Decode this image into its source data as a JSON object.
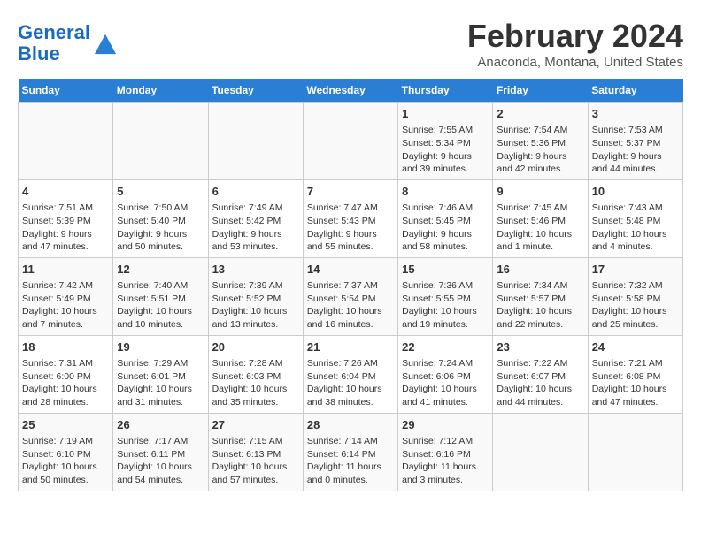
{
  "header": {
    "logo_line1": "General",
    "logo_line2": "Blue",
    "title": "February 2024",
    "subtitle": "Anaconda, Montana, United States"
  },
  "days_of_week": [
    "Sunday",
    "Monday",
    "Tuesday",
    "Wednesday",
    "Thursday",
    "Friday",
    "Saturday"
  ],
  "weeks": [
    [
      {
        "day": "",
        "info": ""
      },
      {
        "day": "",
        "info": ""
      },
      {
        "day": "",
        "info": ""
      },
      {
        "day": "",
        "info": ""
      },
      {
        "day": "1",
        "info": "Sunrise: 7:55 AM\nSunset: 5:34 PM\nDaylight: 9 hours\nand 39 minutes."
      },
      {
        "day": "2",
        "info": "Sunrise: 7:54 AM\nSunset: 5:36 PM\nDaylight: 9 hours\nand 42 minutes."
      },
      {
        "day": "3",
        "info": "Sunrise: 7:53 AM\nSunset: 5:37 PM\nDaylight: 9 hours\nand 44 minutes."
      }
    ],
    [
      {
        "day": "4",
        "info": "Sunrise: 7:51 AM\nSunset: 5:39 PM\nDaylight: 9 hours\nand 47 minutes."
      },
      {
        "day": "5",
        "info": "Sunrise: 7:50 AM\nSunset: 5:40 PM\nDaylight: 9 hours\nand 50 minutes."
      },
      {
        "day": "6",
        "info": "Sunrise: 7:49 AM\nSunset: 5:42 PM\nDaylight: 9 hours\nand 53 minutes."
      },
      {
        "day": "7",
        "info": "Sunrise: 7:47 AM\nSunset: 5:43 PM\nDaylight: 9 hours\nand 55 minutes."
      },
      {
        "day": "8",
        "info": "Sunrise: 7:46 AM\nSunset: 5:45 PM\nDaylight: 9 hours\nand 58 minutes."
      },
      {
        "day": "9",
        "info": "Sunrise: 7:45 AM\nSunset: 5:46 PM\nDaylight: 10 hours\nand 1 minute."
      },
      {
        "day": "10",
        "info": "Sunrise: 7:43 AM\nSunset: 5:48 PM\nDaylight: 10 hours\nand 4 minutes."
      }
    ],
    [
      {
        "day": "11",
        "info": "Sunrise: 7:42 AM\nSunset: 5:49 PM\nDaylight: 10 hours\nand 7 minutes."
      },
      {
        "day": "12",
        "info": "Sunrise: 7:40 AM\nSunset: 5:51 PM\nDaylight: 10 hours\nand 10 minutes."
      },
      {
        "day": "13",
        "info": "Sunrise: 7:39 AM\nSunset: 5:52 PM\nDaylight: 10 hours\nand 13 minutes."
      },
      {
        "day": "14",
        "info": "Sunrise: 7:37 AM\nSunset: 5:54 PM\nDaylight: 10 hours\nand 16 minutes."
      },
      {
        "day": "15",
        "info": "Sunrise: 7:36 AM\nSunset: 5:55 PM\nDaylight: 10 hours\nand 19 minutes."
      },
      {
        "day": "16",
        "info": "Sunrise: 7:34 AM\nSunset: 5:57 PM\nDaylight: 10 hours\nand 22 minutes."
      },
      {
        "day": "17",
        "info": "Sunrise: 7:32 AM\nSunset: 5:58 PM\nDaylight: 10 hours\nand 25 minutes."
      }
    ],
    [
      {
        "day": "18",
        "info": "Sunrise: 7:31 AM\nSunset: 6:00 PM\nDaylight: 10 hours\nand 28 minutes."
      },
      {
        "day": "19",
        "info": "Sunrise: 7:29 AM\nSunset: 6:01 PM\nDaylight: 10 hours\nand 31 minutes."
      },
      {
        "day": "20",
        "info": "Sunrise: 7:28 AM\nSunset: 6:03 PM\nDaylight: 10 hours\nand 35 minutes."
      },
      {
        "day": "21",
        "info": "Sunrise: 7:26 AM\nSunset: 6:04 PM\nDaylight: 10 hours\nand 38 minutes."
      },
      {
        "day": "22",
        "info": "Sunrise: 7:24 AM\nSunset: 6:06 PM\nDaylight: 10 hours\nand 41 minutes."
      },
      {
        "day": "23",
        "info": "Sunrise: 7:22 AM\nSunset: 6:07 PM\nDaylight: 10 hours\nand 44 minutes."
      },
      {
        "day": "24",
        "info": "Sunrise: 7:21 AM\nSunset: 6:08 PM\nDaylight: 10 hours\nand 47 minutes."
      }
    ],
    [
      {
        "day": "25",
        "info": "Sunrise: 7:19 AM\nSunset: 6:10 PM\nDaylight: 10 hours\nand 50 minutes."
      },
      {
        "day": "26",
        "info": "Sunrise: 7:17 AM\nSunset: 6:11 PM\nDaylight: 10 hours\nand 54 minutes."
      },
      {
        "day": "27",
        "info": "Sunrise: 7:15 AM\nSunset: 6:13 PM\nDaylight: 10 hours\nand 57 minutes."
      },
      {
        "day": "28",
        "info": "Sunrise: 7:14 AM\nSunset: 6:14 PM\nDaylight: 11 hours\nand 0 minutes."
      },
      {
        "day": "29",
        "info": "Sunrise: 7:12 AM\nSunset: 6:16 PM\nDaylight: 11 hours\nand 3 minutes."
      },
      {
        "day": "",
        "info": ""
      },
      {
        "day": "",
        "info": ""
      }
    ]
  ]
}
